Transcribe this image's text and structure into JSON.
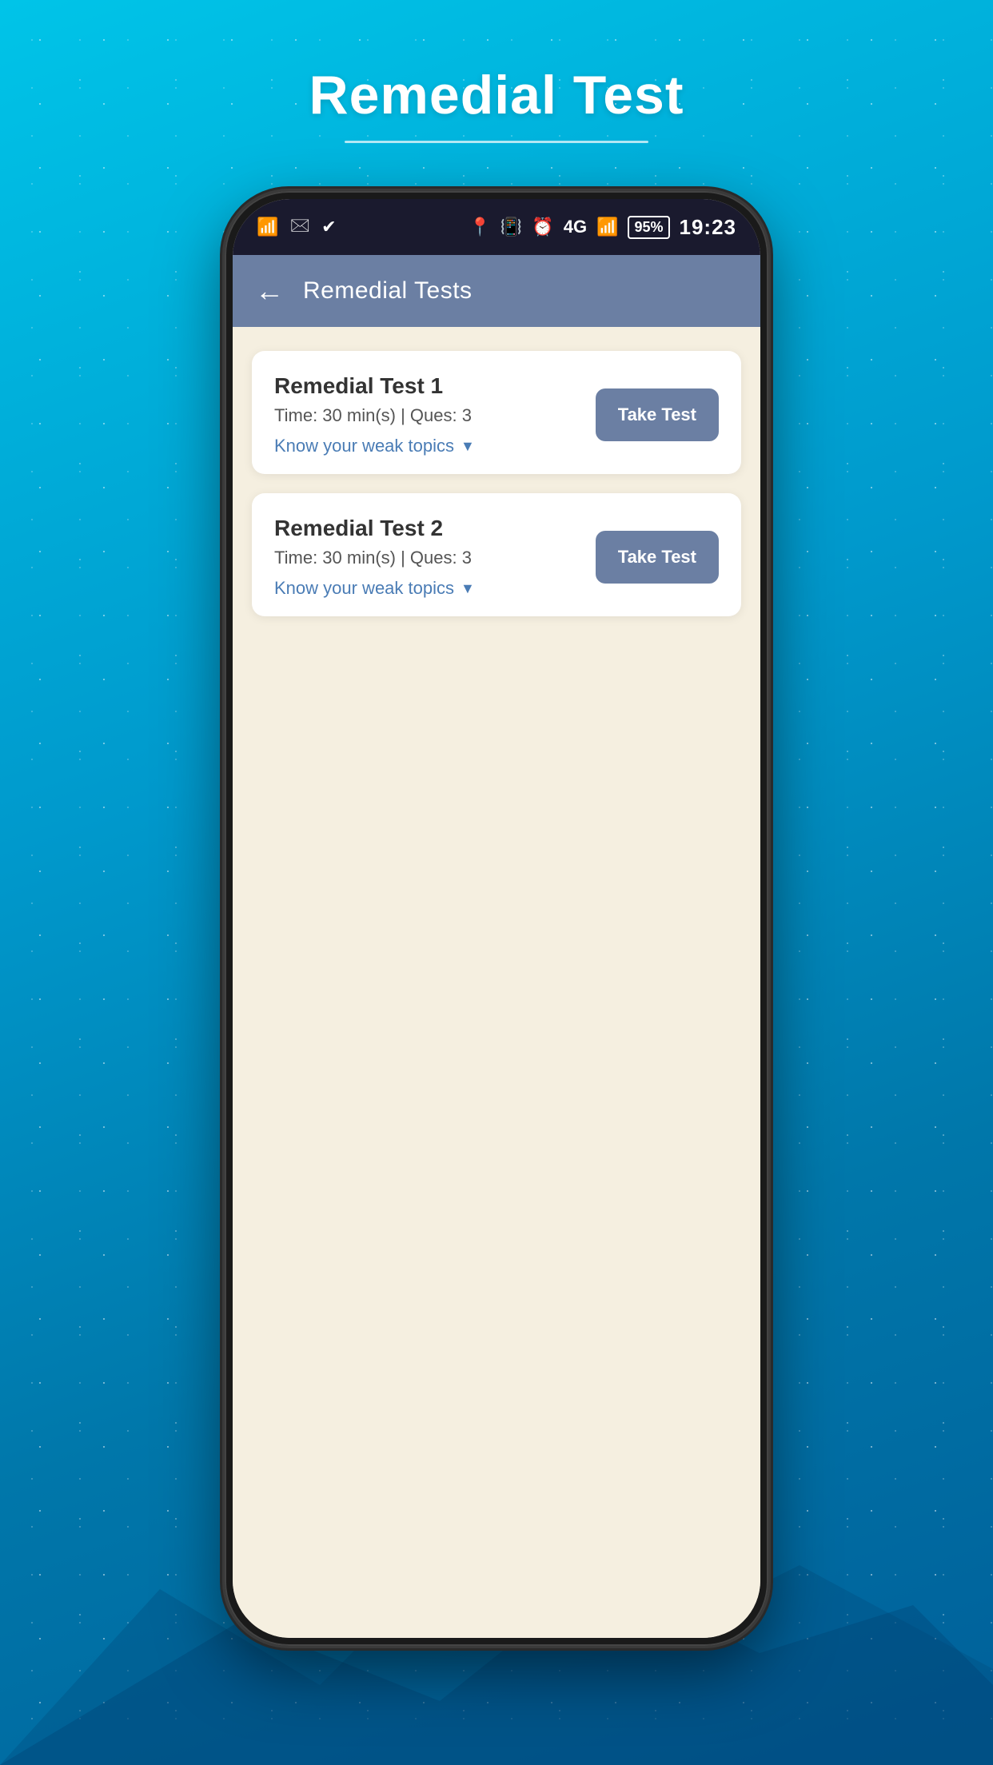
{
  "page": {
    "title": "Remedial Test",
    "title_underline": true
  },
  "status_bar": {
    "time": "19:23",
    "battery_percent": "95%",
    "signal": "4G",
    "icons_left": [
      "wifi-icon",
      "message-icon",
      "check-icon"
    ],
    "icons_right": [
      "location-icon",
      "vibrate-icon",
      "alarm-icon",
      "signal-icon",
      "battery-icon"
    ]
  },
  "app_header": {
    "back_label": "←",
    "title": "Remedial Tests"
  },
  "tests": [
    {
      "id": 1,
      "name": "Remedial Test 1",
      "time_label": "Time: 30 min(s) | Ques: 3",
      "weak_topics_label": "Know your weak topics",
      "take_test_label": "Take Test"
    },
    {
      "id": 2,
      "name": "Remedial Test 2",
      "time_label": "Time: 30 min(s) | Ques: 3",
      "weak_topics_label": "Know your weak topics",
      "take_test_label": "Take Test"
    }
  ]
}
